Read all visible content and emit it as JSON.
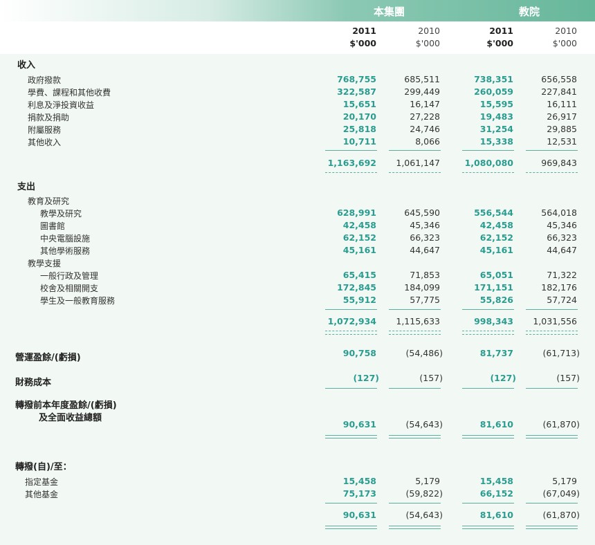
{
  "header": {
    "group": "本集團",
    "institution": "教院",
    "years": {
      "current": "2011",
      "previous": "2010"
    },
    "unit": "$'000"
  },
  "sections": {
    "income": "收入",
    "expenditure": "支出",
    "operating": "營運盈餘/(虧損)",
    "finance": "財務成本",
    "before_transfer_1": "轉撥前本年度盈餘/(虧損)",
    "before_transfer_2": "及全面收益總額",
    "transfer": "轉撥(自)/至："
  },
  "income_rows": [
    {
      "label": "政府撥款",
      "values": [
        "768,755",
        "685,511",
        "738,351",
        "656,558"
      ]
    },
    {
      "label": "學費、課程和其他收費",
      "values": [
        "322,587",
        "299,449",
        "260,059",
        "227,841"
      ]
    },
    {
      "label": "利息及淨投資收益",
      "values": [
        "15,651",
        "16,147",
        "15,595",
        "16,111"
      ]
    },
    {
      "label": "捐款及捐助",
      "values": [
        "20,170",
        "27,228",
        "19,483",
        "26,917"
      ]
    },
    {
      "label": "附屬服務",
      "values": [
        "25,818",
        "24,746",
        "31,254",
        "29,885"
      ]
    },
    {
      "label": "其他收入",
      "values": [
        "10,711",
        "8,066",
        "15,338",
        "12,531"
      ]
    }
  ],
  "income_total": [
    "1,163,692",
    "1,061,147",
    "1,080,080",
    "969,843"
  ],
  "exp_groups": {
    "teaching": "教育及研究",
    "support": "教學支援"
  },
  "teaching_rows": [
    {
      "label": "教學及研究",
      "values": [
        "628,991",
        "645,590",
        "556,544",
        "564,018"
      ]
    },
    {
      "label": "圖書館",
      "values": [
        "42,458",
        "45,346",
        "42,458",
        "45,346"
      ]
    },
    {
      "label": "中央電腦設施",
      "values": [
        "62,152",
        "66,323",
        "62,152",
        "66,323"
      ]
    },
    {
      "label": "其他學術服務",
      "values": [
        "45,161",
        "44,647",
        "45,161",
        "44,647"
      ]
    }
  ],
  "support_rows": [
    {
      "label": "一般行政及管理",
      "values": [
        "65,415",
        "71,853",
        "65,051",
        "71,322"
      ]
    },
    {
      "label": "校舍及相關開支",
      "values": [
        "172,845",
        "184,099",
        "171,151",
        "182,176"
      ]
    },
    {
      "label": "學生及一般教育服務",
      "values": [
        "55,912",
        "57,775",
        "55,826",
        "57,724"
      ]
    }
  ],
  "exp_total": [
    "1,072,934",
    "1,115,633",
    "998,343",
    "1,031,556"
  ],
  "operating_values": [
    "90,758",
    "(54,486)",
    "81,737",
    "(61,713)"
  ],
  "finance_values": [
    "(127)",
    "(157)",
    "(127)",
    "(157)"
  ],
  "before_transfer_values": [
    "90,631",
    "(54,643)",
    "81,610",
    "(61,870)"
  ],
  "transfer_rows": [
    {
      "label": "指定基金",
      "values": [
        "15,458",
        "5,179",
        "15,458",
        "5,179"
      ]
    },
    {
      "label": "其他基金",
      "values": [
        "75,173",
        "(59,822)",
        "66,152",
        "(67,049)"
      ]
    }
  ],
  "transfer_total": [
    "90,631",
    "(54,643)",
    "81,610",
    "(61,870)"
  ]
}
